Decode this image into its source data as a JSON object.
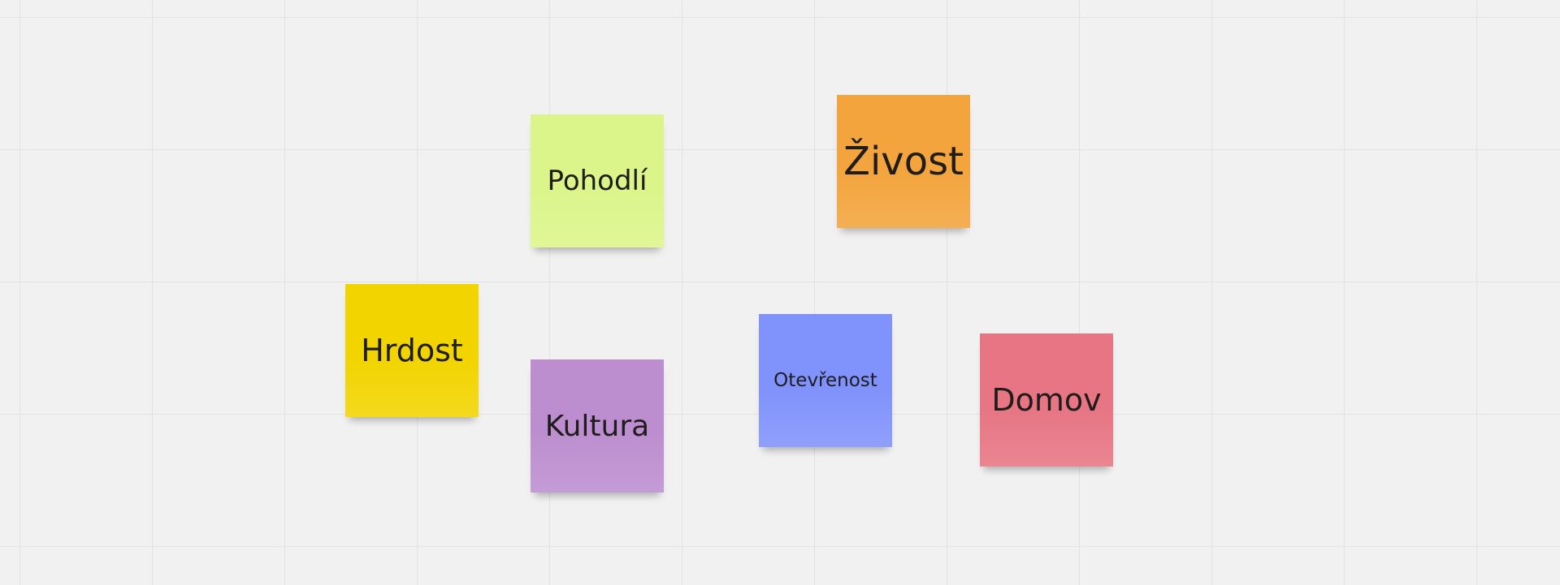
{
  "board": {
    "notes": [
      {
        "id": "pohodli",
        "text": "Pohodlí",
        "color": "#dcf58a"
      },
      {
        "id": "zivost",
        "text": "Živost",
        "color": "#f3a43c"
      },
      {
        "id": "hrdost",
        "text": "Hrdost",
        "color": "#f2d400"
      },
      {
        "id": "kultura",
        "text": "Kultura",
        "color": "#bc8ecf"
      },
      {
        "id": "otevrenost",
        "text": "Otevřenost",
        "color": "#8092fb"
      },
      {
        "id": "domov",
        "text": "Domov",
        "color": "#e77583"
      }
    ]
  }
}
